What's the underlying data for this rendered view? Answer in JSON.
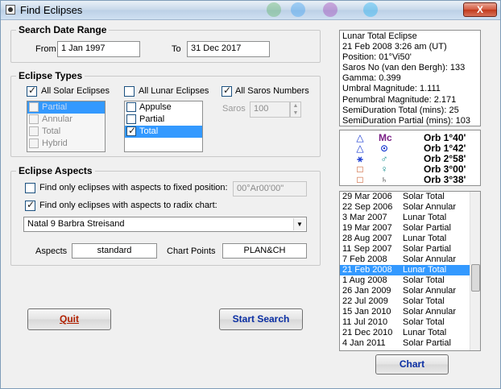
{
  "window": {
    "title": "Find Eclipses",
    "close_label": "X"
  },
  "date_range": {
    "legend": "Search Date Range",
    "from_label": "From",
    "from_value": "1 Jan 1997",
    "to_label": "To",
    "to_value": "31 Dec 2017"
  },
  "eclipse_types": {
    "legend": "Eclipse Types",
    "all_solar_label": "All Solar Eclipses",
    "all_solar_checked": true,
    "all_lunar_label": "All Lunar Eclipses",
    "all_lunar_checked": false,
    "all_saros_label": "All Saros Numbers",
    "all_saros_checked": true,
    "solar_items": [
      {
        "label": "Partial",
        "checked": false,
        "selected": true
      },
      {
        "label": "Annular",
        "checked": false,
        "selected": false
      },
      {
        "label": "Total",
        "checked": false,
        "selected": false
      },
      {
        "label": "Hybrid",
        "checked": false,
        "selected": false
      }
    ],
    "lunar_items": [
      {
        "label": "Appulse",
        "checked": false,
        "selected": false
      },
      {
        "label": "Partial",
        "checked": false,
        "selected": false
      },
      {
        "label": "Total",
        "checked": true,
        "selected": true
      }
    ],
    "saros_label": "Saros",
    "saros_value": "100"
  },
  "eclipse_aspects": {
    "legend": "Eclipse Aspects",
    "fixed_label": "Find only eclipses with aspects to fixed position:",
    "fixed_checked": false,
    "fixed_value": "00°Ar00'00\"",
    "radix_label": "Find only eclipses with aspects to radix chart:",
    "radix_checked": true,
    "chart_selected": "Natal 9 Barbra Streisand",
    "aspects_label": "Aspects",
    "aspects_value": "standard",
    "chart_points_label": "Chart Points",
    "chart_points_value": "PLAN&CH"
  },
  "buttons": {
    "quit": "Quit",
    "start_search": "Start Search",
    "chart": "Chart"
  },
  "info_lines": [
    "Lunar Total Eclipse",
    "21 Feb 2008 3:26 am (UT)",
    "Position: 01°Vi50'",
    "Saros No (van den Bergh): 133",
    "Gamma: 0.399",
    "Umbral Magnitude: 1.111",
    "Penumbral Magnitude: 2.171",
    "SemiDuration Total (mins): 25",
    "SemiDuration Partial (mins): 103"
  ],
  "aspect_rows": [
    {
      "aspect": "△",
      "point": "Mc",
      "orb": "Orb 1°40'",
      "aspect_color": "#1a3bd1",
      "point_color": "#7a1f86"
    },
    {
      "aspect": "△",
      "point": "⊙",
      "orb": "Orb 1°42'",
      "aspect_color": "#1a3bd1",
      "point_color": "#1a3bd1"
    },
    {
      "aspect": "⚹",
      "point": "♂",
      "orb": "Orb 2°58'",
      "aspect_color": "#1a3bd1",
      "point_color": "#0d8a8a"
    },
    {
      "aspect": "□",
      "point": "♀",
      "orb": "Orb 3°00'",
      "aspect_color": "#c2410c",
      "point_color": "#0d8a8a"
    },
    {
      "aspect": "□",
      "point": "♄",
      "orb": "Orb 3°38'",
      "aspect_color": "#c2410c",
      "point_color": "#333333"
    }
  ],
  "eclipse_list": [
    {
      "date": "29 Mar 2006",
      "type": "Solar Total"
    },
    {
      "date": "22 Sep 2006",
      "type": "Solar Annular"
    },
    {
      "date": "3 Mar 2007",
      "type": "Lunar Total"
    },
    {
      "date": "19 Mar 2007",
      "type": "Solar Partial"
    },
    {
      "date": "28 Aug 2007",
      "type": "Lunar Total"
    },
    {
      "date": "11 Sep 2007",
      "type": "Solar Partial"
    },
    {
      "date": "7 Feb 2008",
      "type": "Solar Annular"
    },
    {
      "date": "21 Feb 2008",
      "type": "Lunar Total",
      "selected": true
    },
    {
      "date": "1 Aug 2008",
      "type": "Solar Total"
    },
    {
      "date": "26 Jan 2009",
      "type": "Solar Annular"
    },
    {
      "date": "22 Jul 2009",
      "type": "Solar Total"
    },
    {
      "date": "15 Jan 2010",
      "type": "Solar Annular"
    },
    {
      "date": "11 Jul 2010",
      "type": "Solar Total"
    },
    {
      "date": "21 Dec 2010",
      "type": "Lunar Total"
    },
    {
      "date": "4 Jan 2011",
      "type": "Solar Partial"
    }
  ]
}
